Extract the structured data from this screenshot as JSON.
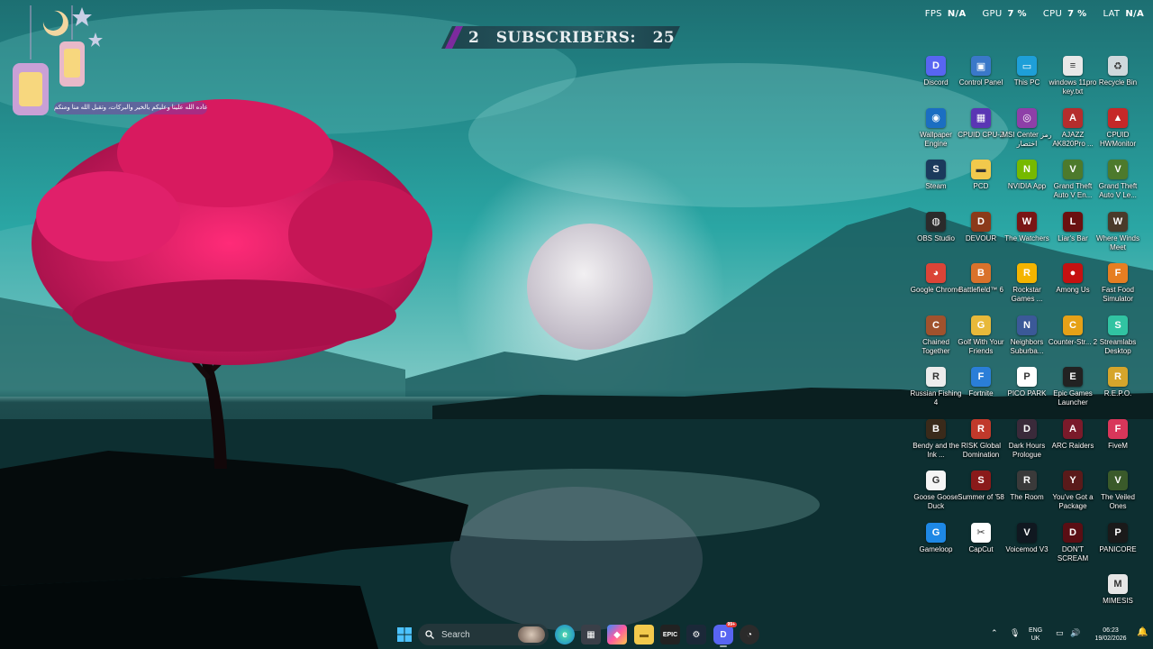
{
  "overlay": {
    "fps_label": "FPS",
    "fps_value": "N/A",
    "gpu_label": "GPU",
    "gpu_value": "7 %",
    "cpu_label": "CPU",
    "cpu_value": "7 %",
    "lat_label": "LAT",
    "lat_value": "N/A"
  },
  "banner": {
    "index": "2",
    "label": "SUBSCRIBERS:",
    "count": "25"
  },
  "greeting": "أعاده الله علينا وعليكم بالخير والبركات، وتقبل الله منا ومنكم",
  "desktop_icons": [
    {
      "label": "Discord",
      "color": "#5865f2",
      "glyph": "D"
    },
    {
      "label": "Control Panel",
      "color": "#3a78c9",
      "glyph": "▣"
    },
    {
      "label": "This PC",
      "color": "#1e9fd8",
      "glyph": "▭"
    },
    {
      "label": "windows 11pro key.txt",
      "color": "#e8e8e8",
      "glyph": "≡"
    },
    {
      "label": "Recycle Bin",
      "color": "#cfd8dc",
      "glyph": "♻"
    },
    {
      "label": "Wallpaper Engine",
      "color": "#1b6ec2",
      "glyph": "◉"
    },
    {
      "label": "CPUID CPU-Z",
      "color": "#5a36b4",
      "glyph": "▦"
    },
    {
      "label": "MSI Center رمز اختصار",
      "color": "#8e3fa8",
      "glyph": "◎"
    },
    {
      "label": "AJAZZ AK820Pro ...",
      "color": "#b52d2d",
      "glyph": "A"
    },
    {
      "label": "CPUID HWMonitor",
      "color": "#c62828",
      "glyph": "▲"
    },
    {
      "label": "Steam",
      "color": "#1b3a5c",
      "glyph": "S"
    },
    {
      "label": "PCD",
      "color": "#f2c94c",
      "glyph": "▬"
    },
    {
      "label": "NVIDIA App",
      "color": "#76b900",
      "glyph": "N"
    },
    {
      "label": "Grand Theft Auto V En...",
      "color": "#4d7a2c",
      "glyph": "V"
    },
    {
      "label": "Grand Theft Auto V Le...",
      "color": "#4d7a2c",
      "glyph": "V"
    },
    {
      "label": "OBS Studio",
      "color": "#2b2b2b",
      "glyph": "◍"
    },
    {
      "label": "DEVOUR",
      "color": "#8b3a1a",
      "glyph": "D"
    },
    {
      "label": "The Watchers",
      "color": "#7a1515",
      "glyph": "W"
    },
    {
      "label": "Liar's Bar",
      "color": "#6b1010",
      "glyph": "L"
    },
    {
      "label": "Where Winds Meet",
      "color": "#4a3a2a",
      "glyph": "W"
    },
    {
      "label": "Google Chrome",
      "color": "#db4437",
      "glyph": "◕"
    },
    {
      "label": "Battlefield™ 6",
      "color": "#d9722b",
      "glyph": "B"
    },
    {
      "label": "Rockstar Games ...",
      "color": "#f4b400",
      "glyph": "R"
    },
    {
      "label": "Among Us",
      "color": "#c51111",
      "glyph": "●"
    },
    {
      "label": "Fast Food Simulator",
      "color": "#e67e22",
      "glyph": "F"
    },
    {
      "label": "Chained Together",
      "color": "#a0522d",
      "glyph": "C"
    },
    {
      "label": "Golf With Your Friends",
      "color": "#e8b93a",
      "glyph": "G"
    },
    {
      "label": "Neighbors Suburba...",
      "color": "#3b5998",
      "glyph": "N"
    },
    {
      "label": "Counter-Str... 2",
      "color": "#e6a117",
      "glyph": "C"
    },
    {
      "label": "Streamlabs Desktop",
      "color": "#31c3a2",
      "glyph": "S"
    },
    {
      "label": "Russian Fishing 4",
      "color": "#ececec",
      "glyph": "R"
    },
    {
      "label": "Fortnite",
      "color": "#2a7ed8",
      "glyph": "F"
    },
    {
      "label": "PICO PARK",
      "color": "#ffffff",
      "glyph": "P"
    },
    {
      "label": "Epic Games Launcher",
      "color": "#222222",
      "glyph": "E"
    },
    {
      "label": "R.E.P.O.",
      "color": "#d6a52b",
      "glyph": "R"
    },
    {
      "label": "Bendy and the Ink ...",
      "color": "#3a2a1a",
      "glyph": "B"
    },
    {
      "label": "RISK Global Domination",
      "color": "#c0392b",
      "glyph": "R"
    },
    {
      "label": "Dark Hours Prologue",
      "color": "#3a2a3a",
      "glyph": "D"
    },
    {
      "label": "ARC Raiders",
      "color": "#7a1a2a",
      "glyph": "A"
    },
    {
      "label": "FiveM",
      "color": "#d8365a",
      "glyph": "F"
    },
    {
      "label": "Goose Goose Duck",
      "color": "#f5f5f5",
      "glyph": "G"
    },
    {
      "label": "Summer of '58",
      "color": "#8a1a1a",
      "glyph": "S"
    },
    {
      "label": "The Room",
      "color": "#3a3a3a",
      "glyph": "R"
    },
    {
      "label": "You've Got a Package",
      "color": "#5a1a1a",
      "glyph": "Y"
    },
    {
      "label": "The Veiled Ones",
      "color": "#3a5a2a",
      "glyph": "V"
    },
    {
      "label": "Gameloop",
      "color": "#1e88e5",
      "glyph": "G"
    },
    {
      "label": "CapCut",
      "color": "#ffffff",
      "glyph": "✂"
    },
    {
      "label": "Voicemod V3",
      "color": "#101820",
      "glyph": "V"
    },
    {
      "label": "DON'T SCREAM",
      "color": "#5a0e14",
      "glyph": "D"
    },
    {
      "label": "PANICORE",
      "color": "#1a1a1a",
      "glyph": "P"
    },
    {
      "label": "MIMESIS",
      "color": "#e6e6e6",
      "glyph": "M"
    }
  ],
  "taskbar": {
    "search_placeholder": "Search",
    "language": "ENG",
    "region": "UK",
    "time": "06:23",
    "date": "19/02/2026",
    "discord_badge": "99+"
  }
}
